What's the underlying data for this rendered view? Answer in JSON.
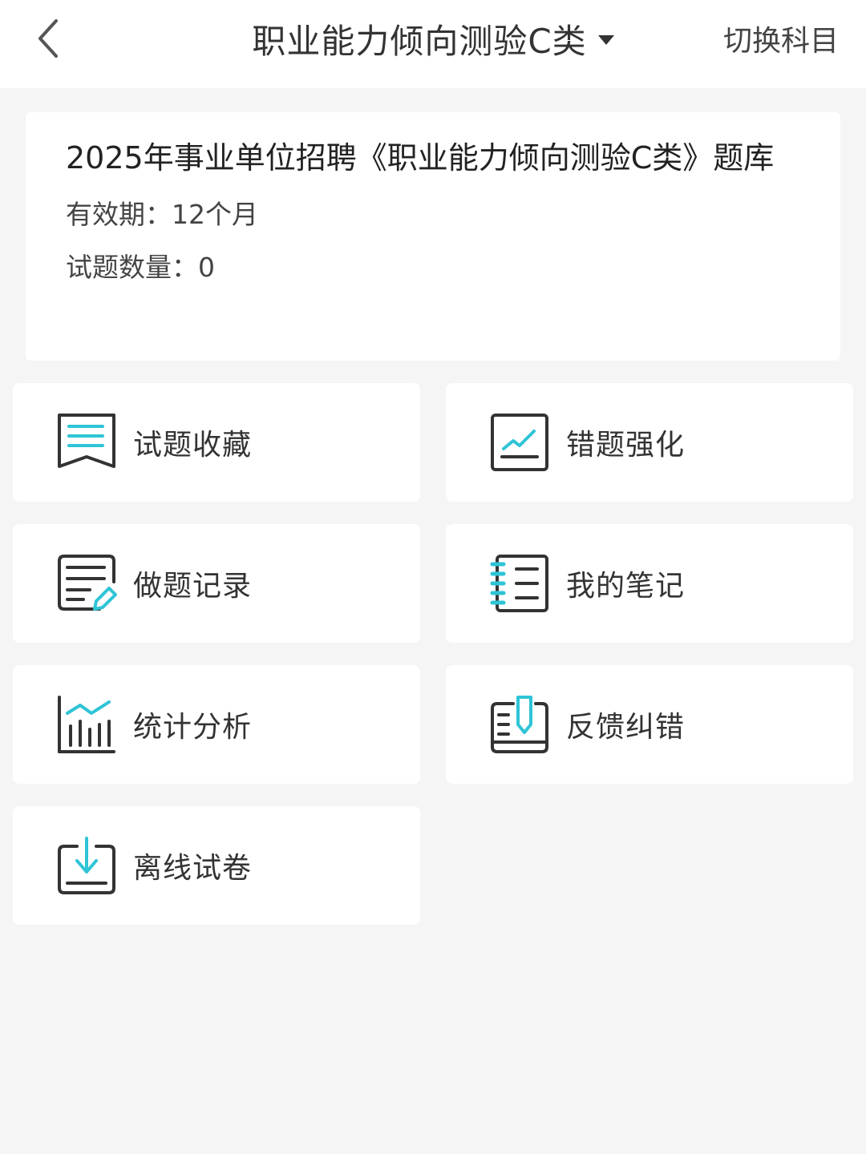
{
  "header": {
    "back_icon": "chevron-left-icon",
    "title": "职业能力倾向测验C类",
    "title_dropdown_icon": "caret-down-icon",
    "switch_label": "切换科目"
  },
  "bank": {
    "name": "2025年事业单位招聘《职业能力倾向测验C类》题库",
    "validity": "有效期：12个月",
    "question_count": "试题数量：0"
  },
  "menu": [
    {
      "label": "试题收藏",
      "icon": "bookmark-list-icon"
    },
    {
      "label": "错题强化",
      "icon": "trend-chart-icon"
    },
    {
      "label": "做题记录",
      "icon": "document-edit-icon"
    },
    {
      "label": "我的笔记",
      "icon": "notebook-icon"
    },
    {
      "label": "统计分析",
      "icon": "bar-chart-icon"
    },
    {
      "label": "反馈纠错",
      "icon": "feedback-icon"
    },
    {
      "label": "离线试卷",
      "icon": "download-icon"
    }
  ],
  "colors": {
    "accent": "#2ec4d6",
    "icon_stroke": "#333333",
    "background": "#f5f5f5",
    "card": "#ffffff"
  }
}
